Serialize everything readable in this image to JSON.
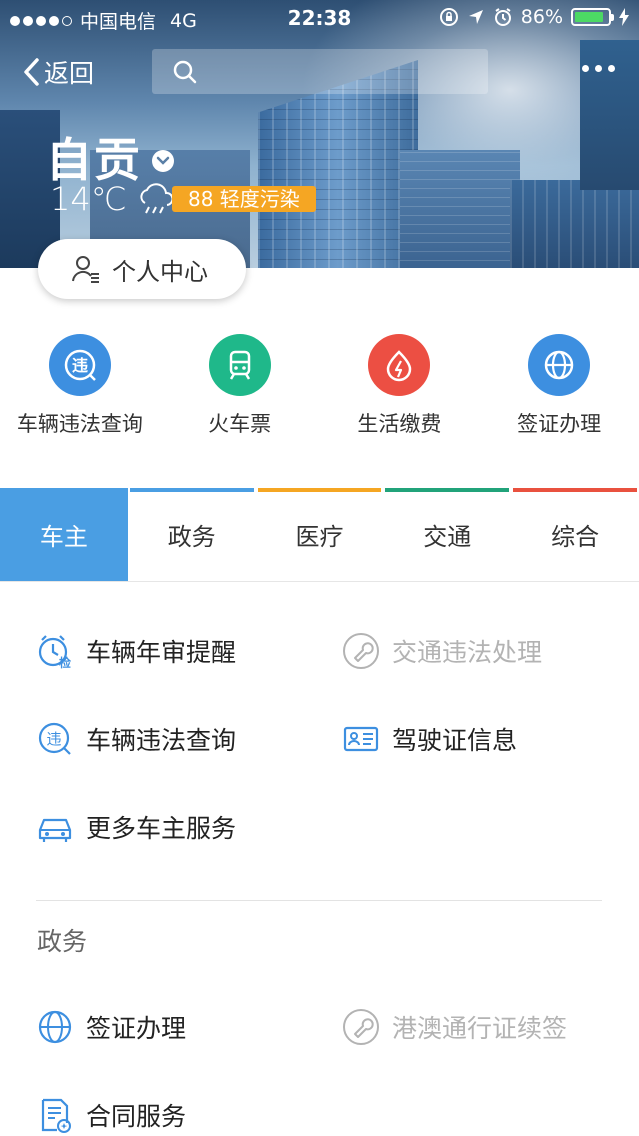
{
  "status_bar": {
    "carrier": "中国电信",
    "network": "4G",
    "time": "22:38",
    "battery": "86%",
    "battery_level": 0.86
  },
  "nav": {
    "back_label": "返回",
    "search_placeholder": ""
  },
  "location": {
    "city": "自贡",
    "temperature": "14℃",
    "air_quality": "88 轻度污染"
  },
  "user_center": {
    "label": "个人中心"
  },
  "quick_services": [
    {
      "label": "车辆违法查询",
      "icon": "violation-icon",
      "color": "#3d8fe0"
    },
    {
      "label": "火车票",
      "icon": "train-icon",
      "color": "#1fb88a"
    },
    {
      "label": "生活缴费",
      "icon": "utility-bill-icon",
      "color": "#ec4f43"
    },
    {
      "label": "签证办理",
      "icon": "globe-icon",
      "color": "#3d8fe0"
    }
  ],
  "tabs": [
    {
      "label": "车主",
      "active": true,
      "color": "#4a9ee3"
    },
    {
      "label": "政务",
      "active": false,
      "color": "#4a9ee3"
    },
    {
      "label": "医疗",
      "active": false,
      "color": "#f5a623"
    },
    {
      "label": "交通",
      "active": false,
      "color": "#21a37a"
    },
    {
      "label": "综合",
      "active": false,
      "color": "#e9513f"
    }
  ],
  "car_owner_services": [
    {
      "label": "车辆年审提醒",
      "icon": "annual-inspection-icon",
      "enabled": true
    },
    {
      "label": "交通违法处理",
      "icon": "wrench-icon",
      "enabled": false
    },
    {
      "label": "车辆违法查询",
      "icon": "violation-icon",
      "enabled": true
    },
    {
      "label": "驾驶证信息",
      "icon": "license-card-icon",
      "enabled": true
    },
    {
      "label": "更多车主服务",
      "icon": "car-icon",
      "enabled": true
    }
  ],
  "government": {
    "title": "政务",
    "services": [
      {
        "label": "签证办理",
        "icon": "globe-icon",
        "enabled": true
      },
      {
        "label": "港澳通行证续签",
        "icon": "wrench-icon",
        "enabled": false
      },
      {
        "label": "合同服务",
        "icon": "contract-icon",
        "enabled": true
      }
    ]
  },
  "colors": {
    "accent": "#4a9ee3",
    "icon_blue": "#3d8fe0",
    "aqi_badge": "#f5a623"
  }
}
